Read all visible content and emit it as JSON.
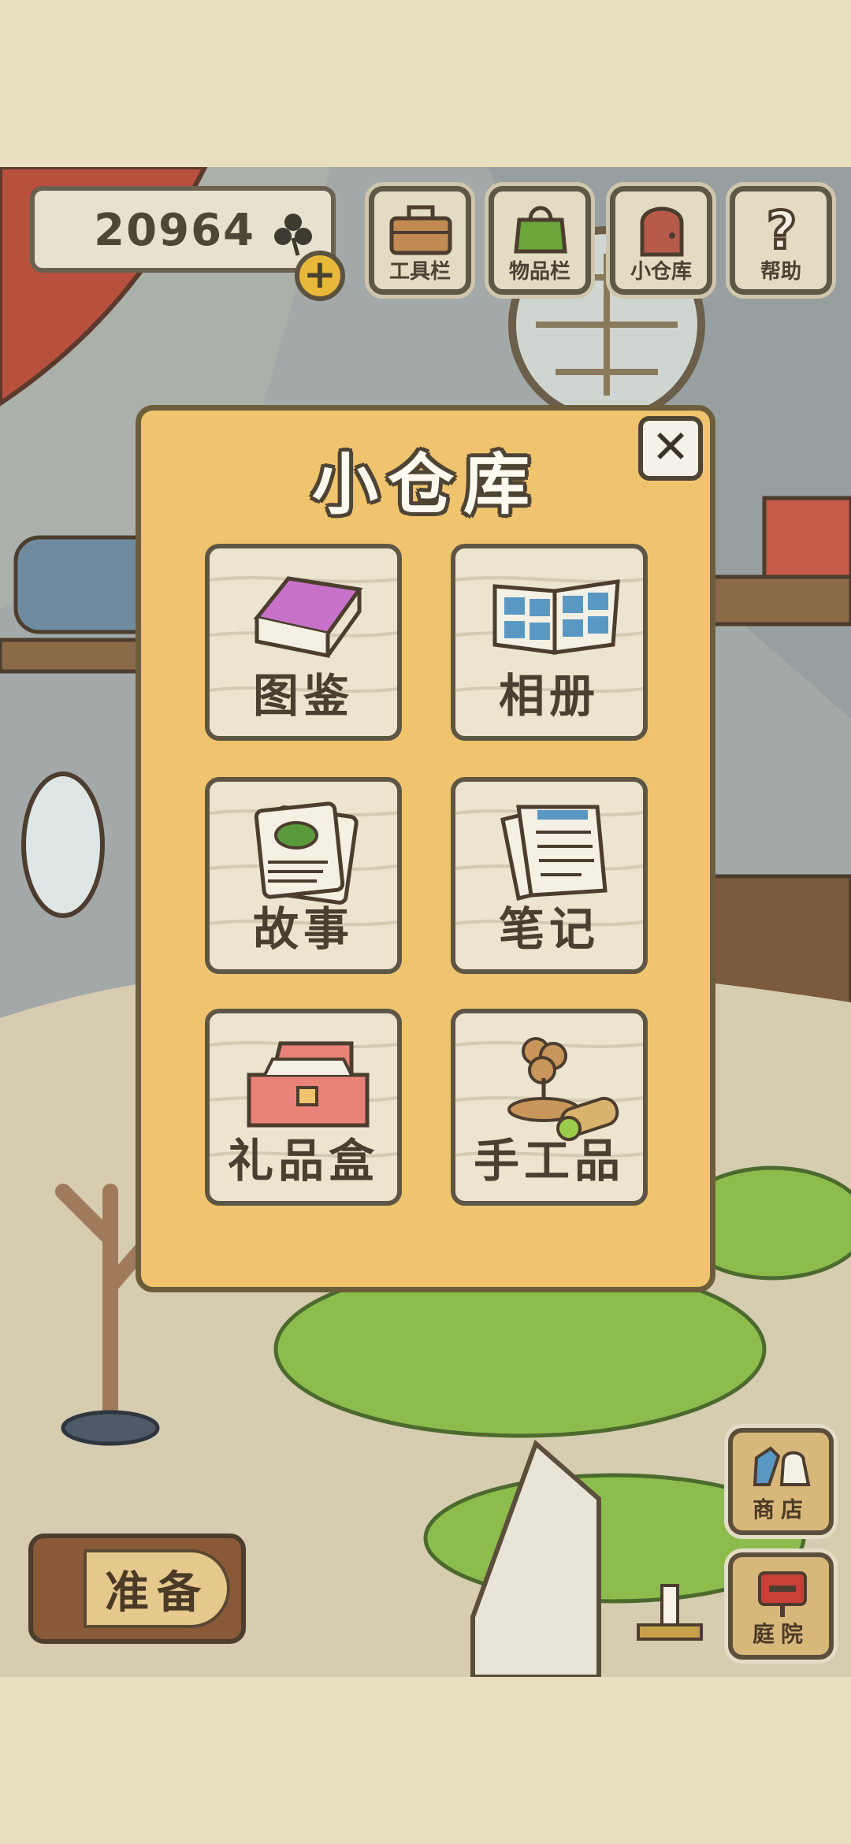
{
  "currency": {
    "amount": "20964",
    "icon": "clover-icon",
    "add_icon": "plus-icon"
  },
  "top_bar": {
    "toolbar": {
      "label": "工具栏",
      "icon": "toolbox-icon"
    },
    "items": {
      "label": "物品栏",
      "icon": "bag-icon"
    },
    "storage": {
      "label": "小仓库",
      "icon": "door-icon"
    },
    "help": {
      "label": "帮助",
      "icon": "question-icon"
    }
  },
  "modal": {
    "title": "小仓库",
    "close_icon": "close-icon",
    "tiles": [
      {
        "label": "图鉴",
        "icon": "book-icon"
      },
      {
        "label": "相册",
        "icon": "album-icon"
      },
      {
        "label": "故事",
        "icon": "story-cards-icon"
      },
      {
        "label": "笔记",
        "icon": "notes-icon"
      },
      {
        "label": "礼品盒",
        "icon": "gift-box-icon"
      },
      {
        "label": "手工品",
        "icon": "crafts-icon"
      }
    ]
  },
  "bottom": {
    "prepare": {
      "label": "准备"
    },
    "shop": {
      "label": "商店",
      "icon": "shop-icon"
    },
    "yard": {
      "label": "庭院",
      "icon": "mailbox-icon"
    }
  },
  "colors": {
    "modal_bg": "#f0c46e",
    "tile_bg": "#ece4cf",
    "outline": "#5d5645",
    "grass": "#8cbc4c"
  }
}
